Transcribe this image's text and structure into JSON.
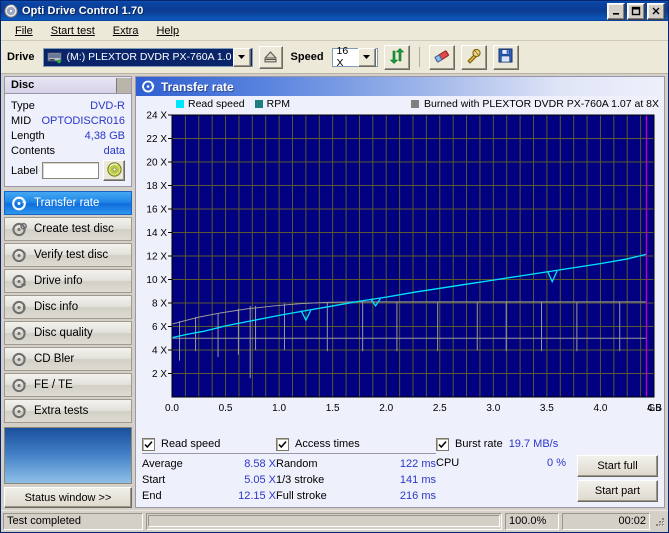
{
  "window": {
    "title": "Opti Drive Control 1.70",
    "icon": "disc-icon",
    "minimize_label": "_",
    "maximize_label": "□",
    "close_label": "✕"
  },
  "menu": {
    "items": [
      {
        "label": "File",
        "accel": "F"
      },
      {
        "label": "Start test",
        "accel": "S"
      },
      {
        "label": "Extra",
        "accel": "x"
      },
      {
        "label": "Help",
        "accel": "H"
      }
    ]
  },
  "toolbar": {
    "drive_label": "Drive",
    "drive_value": "(M:)   PLEXTOR DVDR   PX-760A 1.07",
    "drive_icon": "drive-icon",
    "eject_icon": "eject-icon",
    "speed_label": "Speed",
    "speed_value": "16 X",
    "refresh_icon": "refresh-icon",
    "erase_icon": "eraser-icon",
    "tools_icon": "tools-icon",
    "save_icon": "save-icon"
  },
  "disc": {
    "panel_title": "Disc",
    "rows": [
      {
        "key": "Type",
        "value": "DVD-R"
      },
      {
        "key": "MID",
        "value": "OPTODISCR016"
      },
      {
        "key": "Length",
        "value": "4,38 GB"
      },
      {
        "key": "Contents",
        "value": "data"
      }
    ],
    "label_key": "Label",
    "label_value": "",
    "label_placeholder": "",
    "disc_button_icon": "disc-icon"
  },
  "sidebar": {
    "items": [
      {
        "label": "Transfer rate",
        "icon": "transfer-rate-icon",
        "active": true
      },
      {
        "label": "Create test disc",
        "icon": "create-disc-icon",
        "active": false
      },
      {
        "label": "Verify test disc",
        "icon": "verify-disc-icon",
        "active": false
      },
      {
        "label": "Drive info",
        "icon": "drive-info-icon",
        "active": false
      },
      {
        "label": "Disc info",
        "icon": "disc-info-icon",
        "active": false
      },
      {
        "label": "Disc quality",
        "icon": "disc-quality-icon",
        "active": false
      },
      {
        "label": "CD Bler",
        "icon": "cd-bler-icon",
        "active": false
      },
      {
        "label": "FE / TE",
        "icon": "fe-te-icon",
        "active": false
      },
      {
        "label": "Extra tests",
        "icon": "extra-tests-icon",
        "active": false
      }
    ],
    "status_window_label": "Status window >>"
  },
  "main": {
    "title": "Transfer rate",
    "icon": "transfer-rate-icon",
    "legend": {
      "read_speed": "Read speed",
      "read_speed_color": "#00e5ff",
      "rpm": "RPM",
      "rpm_color": "#1d7f7f",
      "burned_with": "Burned with PLEXTOR DVDR   PX-760A 1.07 at 8X",
      "burned_with_color": "#808080"
    }
  },
  "chart_data": {
    "type": "line",
    "title": "Transfer rate",
    "xlabel": "GB",
    "ylabel": "X",
    "xlim": [
      0.0,
      4.5
    ],
    "ylim": [
      0,
      24
    ],
    "xticks": [
      "0.0",
      "0.5",
      "1.0",
      "1.5",
      "2.0",
      "2.5",
      "3.0",
      "3.5",
      "4.0",
      "4.5"
    ],
    "xtick_values": [
      0.0,
      0.5,
      1.0,
      1.5,
      2.0,
      2.5,
      3.0,
      3.5,
      4.0,
      4.5
    ],
    "x_unit": "GB",
    "yticks": [
      "2 X",
      "4 X",
      "6 X",
      "8 X",
      "10 X",
      "12 X",
      "14 X",
      "16 X",
      "18 X",
      "20 X",
      "22 X",
      "24 X"
    ],
    "ytick_values": [
      2,
      4,
      6,
      8,
      10,
      12,
      14,
      16,
      18,
      20,
      22,
      24
    ],
    "grid": true,
    "legend_position": "top",
    "plot_bg": "#000080",
    "grid_color": "#5a5a2e",
    "end_marker_x": 4.43,
    "end_marker_color": "#c000c0",
    "series": [
      {
        "name": "Read speed",
        "color": "#00e5ff",
        "x": [
          0.0,
          0.15,
          0.3,
          0.5,
          0.75,
          1.0,
          1.25,
          1.5,
          1.75,
          2.0,
          2.25,
          2.5,
          2.75,
          3.0,
          3.25,
          3.5,
          3.75,
          4.0,
          4.25,
          4.43
        ],
        "values": [
          5.05,
          5.35,
          5.6,
          6.05,
          6.5,
          6.95,
          7.35,
          7.75,
          8.15,
          8.5,
          8.9,
          9.25,
          9.6,
          9.95,
          10.3,
          10.65,
          11.0,
          11.35,
          11.75,
          12.15
        ],
        "dips_x": [
          1.25,
          1.9,
          3.55
        ],
        "dips_depth": [
          0.8,
          0.6,
          0.9
        ]
      },
      {
        "name": "RPM",
        "color": "#9a9a9a",
        "x": [
          0.0,
          0.1,
          0.25,
          0.45,
          0.7,
          0.95,
          1.2,
          1.45,
          1.7,
          2.0,
          2.5,
          3.0,
          3.5,
          4.0,
          4.43
        ],
        "values": [
          6.2,
          6.45,
          6.8,
          7.15,
          7.5,
          7.75,
          7.95,
          8.05,
          8.1,
          8.1,
          8.1,
          8.1,
          8.1,
          8.1,
          8.1
        ],
        "baseline": 5.0,
        "spikes_x": [
          0.07,
          0.22,
          0.43,
          0.62,
          0.73,
          0.78,
          1.05,
          1.45,
          1.78,
          2.1,
          2.48,
          2.85,
          3.12,
          3.45,
          3.78,
          4.18
        ],
        "spikes_bottom": [
          3.1,
          3.9,
          3.4,
          3.6,
          1.6,
          4.0,
          4.0,
          3.9,
          3.9,
          3.9,
          3.9,
          3.95,
          3.9,
          3.9,
          3.9,
          3.9
        ]
      }
    ]
  },
  "stats": {
    "read_speed": {
      "title": "Read speed",
      "checked": true,
      "rows": [
        {
          "key": "Average",
          "value": "8.58 X"
        },
        {
          "key": "Start",
          "value": "5.05 X"
        },
        {
          "key": "End",
          "value": "12.15 X"
        }
      ]
    },
    "access_times": {
      "title": "Access times",
      "checked": true,
      "rows": [
        {
          "key": "Random",
          "value": "122 ms"
        },
        {
          "key": "1/3 stroke",
          "value": "141 ms"
        },
        {
          "key": "Full stroke",
          "value": "216 ms"
        }
      ]
    },
    "burst": {
      "title": "Burst rate",
      "checked": true,
      "value": "19.7 MB/s",
      "cpu_key": "CPU",
      "cpu_value": "0 %"
    },
    "buttons": {
      "start_full": "Start full",
      "start_part": "Start part"
    }
  },
  "statusbar": {
    "message": "Test completed",
    "progress_percent": 100.0,
    "progress_text": "100.0%",
    "elapsed": "00:02"
  }
}
